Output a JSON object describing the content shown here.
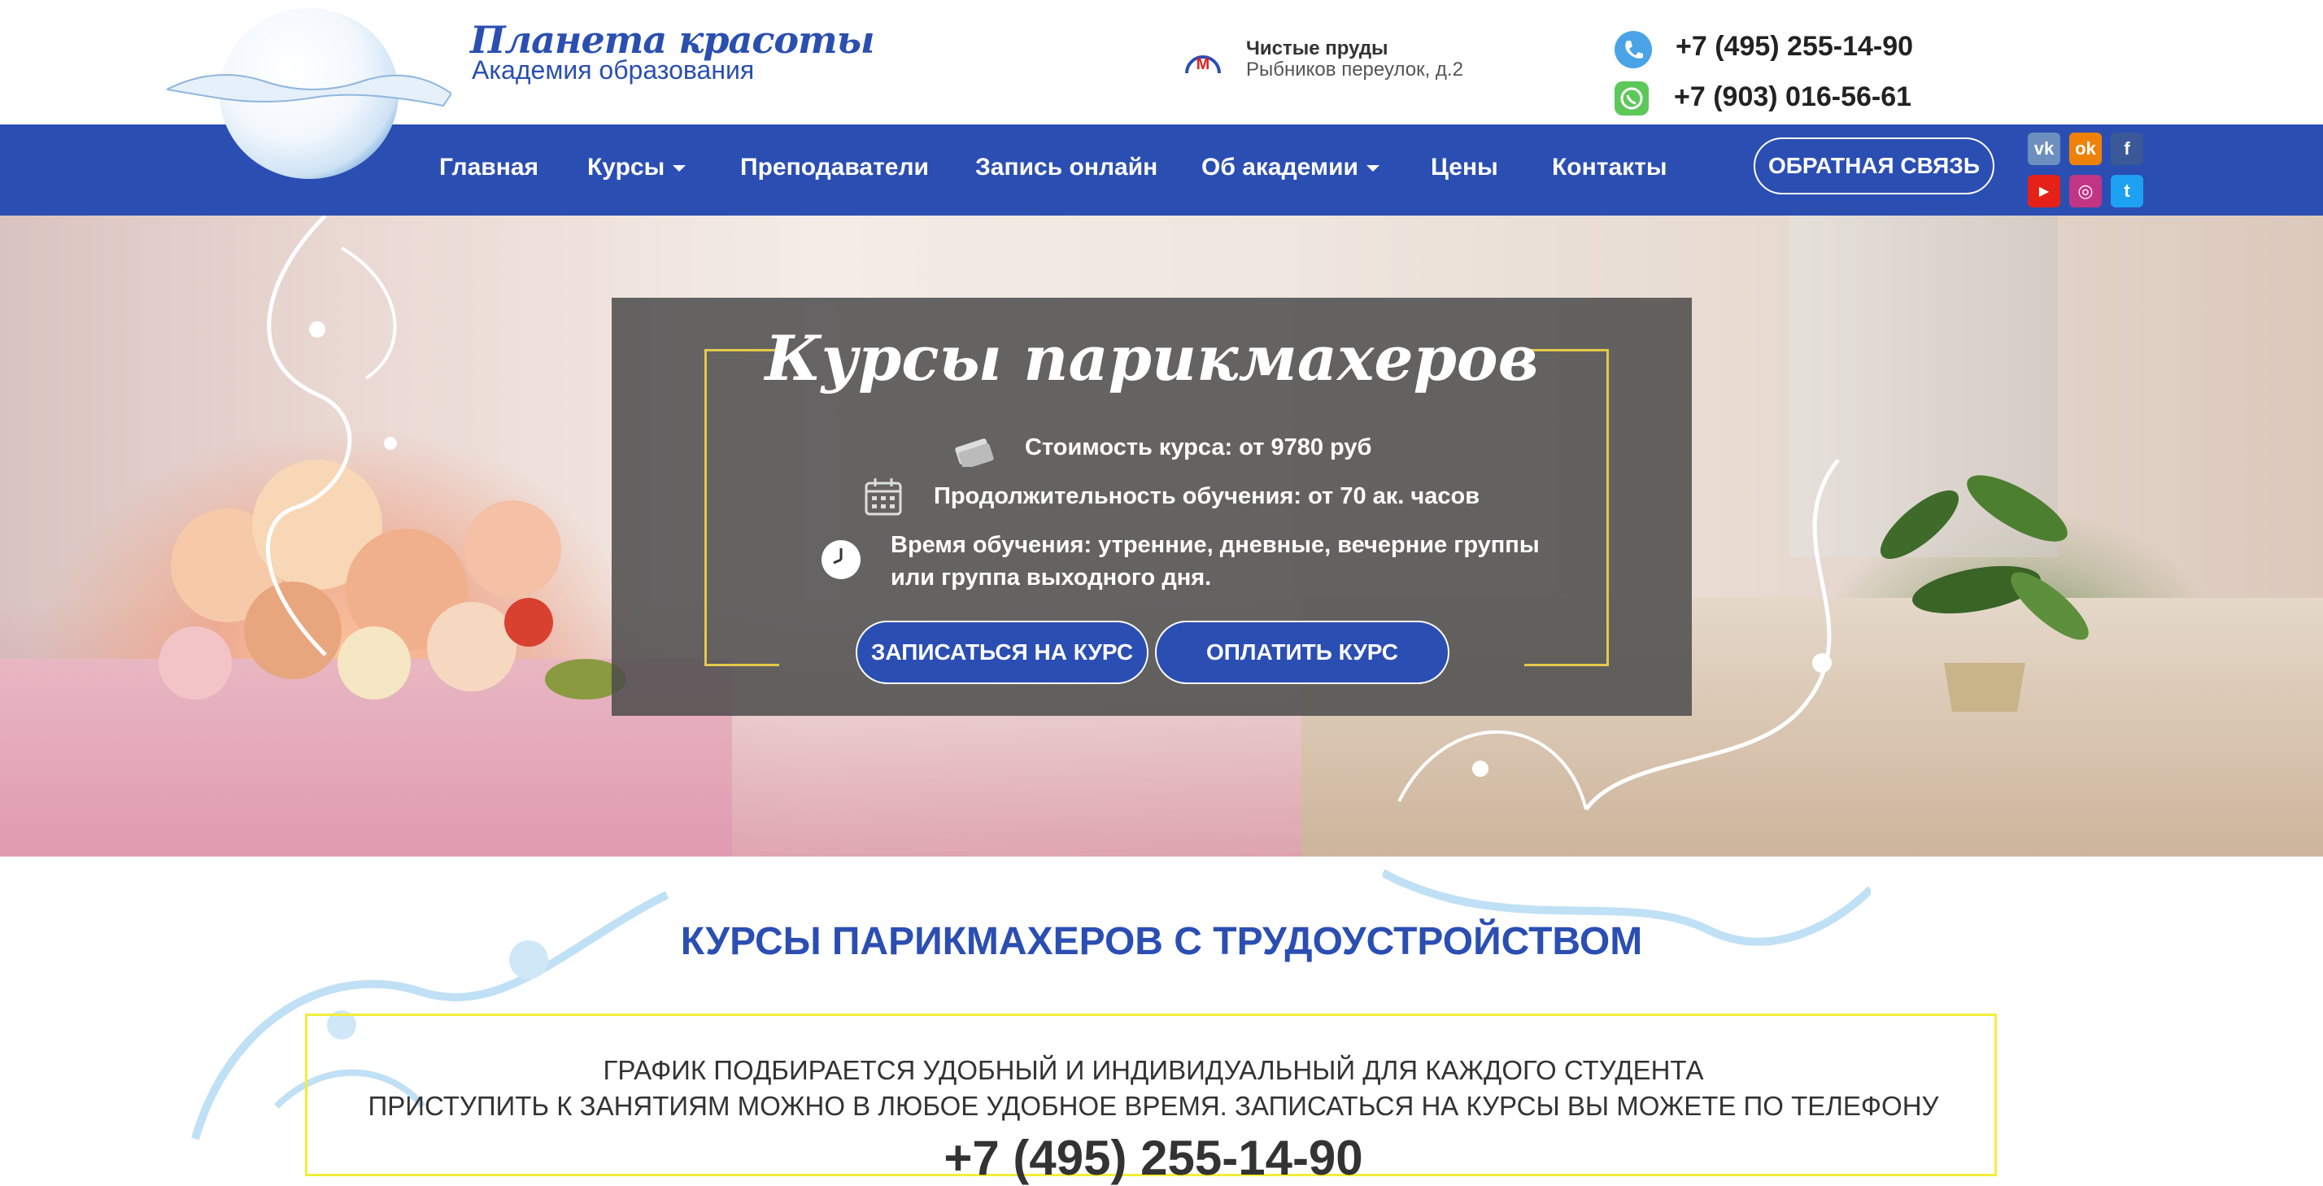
{
  "brand": {
    "title": "Планета красоты",
    "subtitle": "Академия образования"
  },
  "contacts": {
    "metro_station": "Чистые пруды",
    "address": "Рыбников переулок, д.2",
    "phone_primary": "+7 (495) 255-14-90",
    "phone_whatsapp": "+7 (903) 016-56-61",
    "metro_letter": "М"
  },
  "nav": {
    "items": [
      {
        "label": "Главная",
        "dropdown": false
      },
      {
        "label": "Курсы",
        "dropdown": true
      },
      {
        "label": "Преподаватели",
        "dropdown": false
      },
      {
        "label": "Запись онлайн",
        "dropdown": false
      },
      {
        "label": "Об академии",
        "dropdown": true
      },
      {
        "label": "Цены",
        "dropdown": false
      },
      {
        "label": "Контакты",
        "dropdown": false
      }
    ],
    "callback_label": "ОБРАТНАЯ СВЯЗЬ"
  },
  "social": {
    "vk": "vk",
    "ok": "ok",
    "facebook": "f",
    "youtube": "▶",
    "instagram": "◎",
    "twitter": "t"
  },
  "hero": {
    "title": "Курсы парикмахеров",
    "price": "Стоимость курса: от 9780 руб",
    "duration": "Продолжительность обучения: от 70 ак. часов",
    "schedule_line1": "Время обучения: утренние, дневные, вечерние группы",
    "schedule_line2": "или группа выходного дня.",
    "enroll_button": "ЗАПИСАТЬСЯ НА КУРС",
    "pay_button": "ОПЛАТИТЬ КУРС"
  },
  "section": {
    "title": "КУРСЫ ПАРИКМАХЕРОВ С ТРУДОУСТРОЙСТВОМ",
    "line1": "ГРАФИК ПОДБИРАЕТСЯ УДОБНЫЙ И ИНДИВИДУАЛЬНЫЙ ДЛЯ КАЖДОГО СТУДЕНТА",
    "line2": "ПРИСТУПИТЬ К ЗАНЯТИЯМ МОЖНО В ЛЮБОЕ УДОБНОЕ ВРЕМЯ. ЗАПИСАТЬСЯ НА КУРСЫ ВЫ МОЖЕТЕ ПО ТЕЛЕФОНУ",
    "phone": "+7 (495) 255-14-90"
  },
  "colors": {
    "brand_blue": "#2b4eb3",
    "accent_yellow": "#e3c94a",
    "box_border": "#f1ee3a"
  }
}
